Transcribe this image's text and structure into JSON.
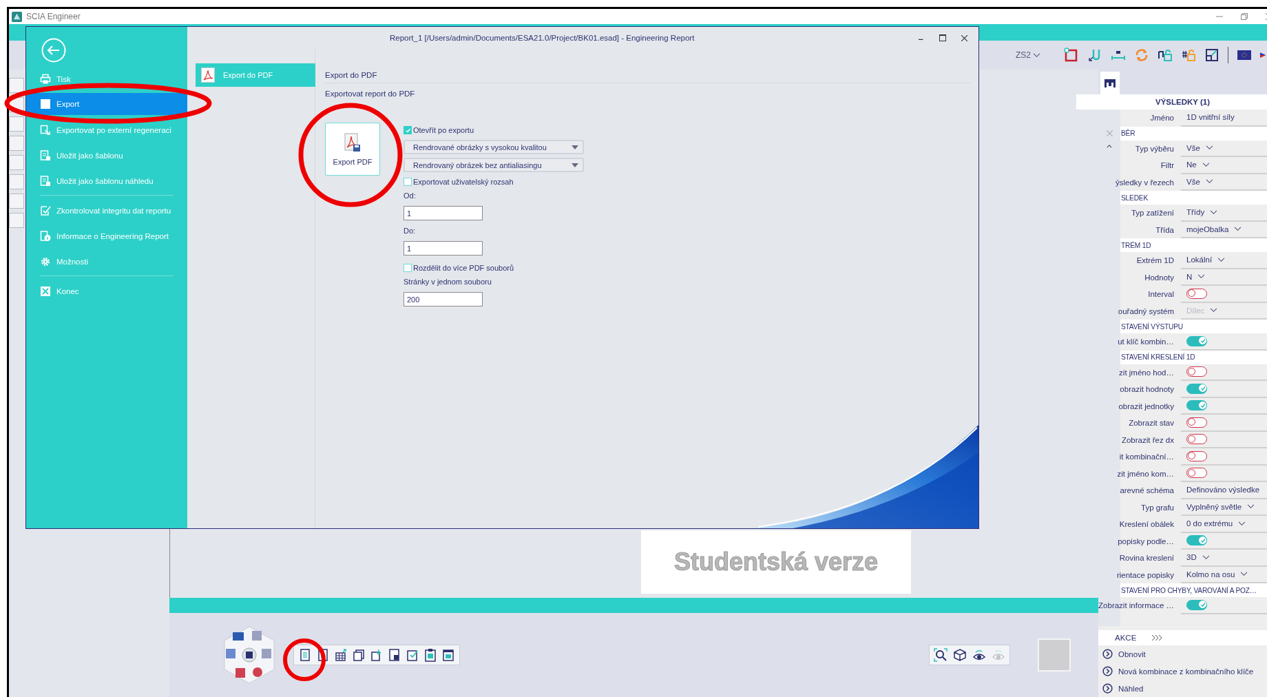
{
  "app": {
    "title": "SCIA Engineer"
  },
  "toolbar": {
    "combo": "ZS2"
  },
  "dialog": {
    "title": "Report_1 [/Users/admin/Documents/ESA21.0/Project/BK01.esad] - Engineering Report",
    "sidebar_groups": [
      {
        "items": [
          {
            "label": "Tisk",
            "selected": false
          },
          {
            "label": "Export",
            "selected": true
          },
          {
            "label": "Exportovat po externí regeneraci",
            "selected": false
          },
          {
            "label": "Uložit jako šablonu",
            "selected": false
          },
          {
            "label": "Uložit jako šablonu náhledu",
            "selected": false
          }
        ]
      },
      {
        "items": [
          {
            "label": "Zkontrolovat integritu dat reportu",
            "selected": false
          },
          {
            "label": "Informace o Engineering Report",
            "selected": false
          },
          {
            "label": "Možnosti",
            "selected": false
          }
        ]
      },
      {
        "items": [
          {
            "label": "Konec",
            "selected": false
          }
        ]
      }
    ],
    "subnav": [
      {
        "label": "Export do PDF",
        "selected": true
      }
    ],
    "heading": "Export do PDF",
    "subheading": "Exportovat report do PDF",
    "export_button": "Export PDF",
    "options": [
      {
        "kind": "checkbox",
        "label": "Otevřít po exportu",
        "checked": true
      },
      {
        "kind": "dropdown",
        "value": "Rendrované obrázky s vysokou kvalitou"
      },
      {
        "kind": "dropdown",
        "value": "Rendrovaný obrázek bez antialiasingu"
      },
      {
        "kind": "checkbox",
        "label": "Exportovat uživatelský rozsah",
        "checked": false
      },
      {
        "kind": "label",
        "label": "Od:"
      },
      {
        "kind": "input",
        "value": "1"
      },
      {
        "kind": "label",
        "label": "Do:"
      },
      {
        "kind": "input",
        "value": "1"
      },
      {
        "kind": "checkbox",
        "label": "Rozdělit do více PDF souborů",
        "checked": false
      },
      {
        "kind": "label",
        "label": "Stránky v jednom souboru"
      },
      {
        "kind": "input",
        "value": "200"
      }
    ]
  },
  "canvas": {
    "stamp": "Studentská verze"
  },
  "properties": {
    "title": "VÝSLEDKY (1)",
    "rows": [
      {
        "kind": "text",
        "label": "Jméno",
        "value": "1D vnitřní síly"
      },
      {
        "kind": "section",
        "label": "BĚR"
      },
      {
        "kind": "dropdown",
        "label": "Typ výběru",
        "value": "Vše",
        "disabled": false
      },
      {
        "kind": "dropdown",
        "label": "Filtr",
        "value": "Ne",
        "disabled": false
      },
      {
        "kind": "dropdown",
        "label": "ýsledky v řezech",
        "value": "Vše",
        "disabled": false
      },
      {
        "kind": "section",
        "label": "SLEDEK"
      },
      {
        "kind": "dropdown",
        "label": "Typ zatížení",
        "value": "Třídy",
        "disabled": false
      },
      {
        "kind": "dropdown",
        "label": "Třída",
        "value": "mojeObalka",
        "disabled": false
      },
      {
        "kind": "section",
        "label": "TRÉM 1D"
      },
      {
        "kind": "dropdown",
        "label": "Extrém 1D",
        "value": "Lokální",
        "disabled": false
      },
      {
        "kind": "dropdown",
        "label": "Hodnoty",
        "value": "N",
        "disabled": false
      },
      {
        "kind": "toggle",
        "label": "Interval",
        "on": false
      },
      {
        "kind": "dropdown",
        "label": "ouřadný systém",
        "value": "Dílec",
        "disabled": true
      },
      {
        "kind": "section",
        "label": "STAVENÍ VÝSTUPU"
      },
      {
        "kind": "toggle",
        "label": "ut klíč kombin…",
        "on": true
      },
      {
        "kind": "section",
        "label": "STAVENÍ KRESLENÍ 1D"
      },
      {
        "kind": "toggle",
        "label": "zit jméno hod…",
        "on": false
      },
      {
        "kind": "toggle",
        "label": "obrazit hodnoty",
        "on": true
      },
      {
        "kind": "toggle",
        "label": "obrazit jednotky",
        "on": true
      },
      {
        "kind": "toggle",
        "label": "Zobrazit stav",
        "on": false
      },
      {
        "kind": "toggle",
        "label": "Zobrazit řez dx",
        "on": false
      },
      {
        "kind": "toggle",
        "label": "it kombinační…",
        "on": false
      },
      {
        "kind": "toggle",
        "label": "zit jméno kom…",
        "on": false
      },
      {
        "kind": "text",
        "label": "arevné schéma",
        "value": "Definováno výsledke"
      },
      {
        "kind": "dropdown",
        "label": "Typ grafu",
        "value": "Vyplněný světle",
        "disabled": false
      },
      {
        "kind": "dropdown",
        "label": "Kreslení obálek",
        "value": "0 do extrému",
        "disabled": false
      },
      {
        "kind": "toggle",
        "label": "popisky podle…",
        "on": true
      },
      {
        "kind": "dropdown",
        "label": "Rovina kreslení",
        "value": "3D",
        "disabled": false
      },
      {
        "kind": "dropdown",
        "label": "rientace popisky",
        "value": "Kolmo na osu",
        "disabled": false
      },
      {
        "kind": "section",
        "label": "STAVENÍ PRO CHYBY, VAROVÁNÍ A POZ…"
      },
      {
        "kind": "toggle",
        "label": "Zobrazit informace …",
        "on": true
      }
    ],
    "actions_title": "AKCE",
    "actions": [
      "Obnovit",
      "Nová kombinace z kombinačního klíče",
      "Náhled"
    ]
  }
}
